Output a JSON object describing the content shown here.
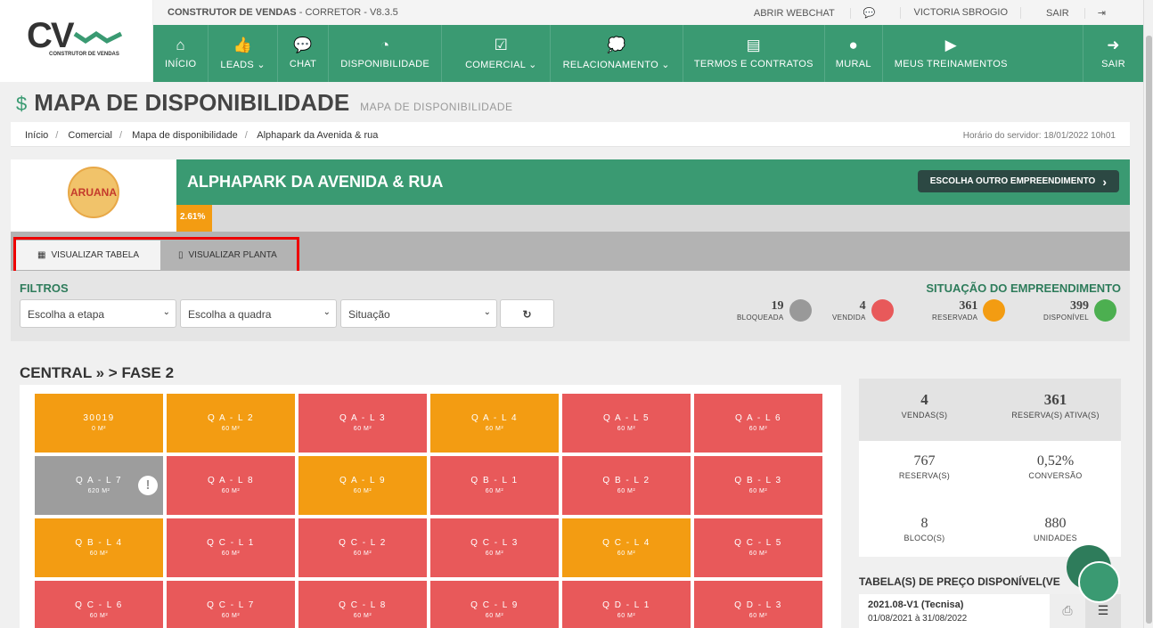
{
  "app": {
    "name": "CONSTRUTOR DE VENDAS",
    "role": "CORRETOR",
    "version": "V8.3.5",
    "logo_text": "CV",
    "logo_sub": "CONSTRUTOR DE VENDAS"
  },
  "topbar": {
    "webchat": "ABRIR WEBCHAT",
    "user": "VICTORIA SBROGIO",
    "logout": "SAIR"
  },
  "nav": [
    {
      "label": "INÍCIO",
      "icon": "home-icon"
    },
    {
      "label": "LEADS ⌄",
      "icon": "thumbs-up-icon"
    },
    {
      "label": "CHAT",
      "icon": "chat-icon"
    },
    {
      "label": "DISPONIBILIDADE",
      "icon": "dashboard-icon"
    },
    {
      "label": "COMERCIAL ⌄",
      "icon": "check-icon"
    },
    {
      "label": "RELACIONAMENTO ⌄",
      "icon": "comments-icon"
    },
    {
      "label": "TERMOS E CONTRATOS",
      "icon": "document-icon"
    },
    {
      "label": "MURAL",
      "icon": "speech-icon"
    },
    {
      "label": "MEUS TREINAMENTOS",
      "icon": "play-icon"
    },
    {
      "label": "SAIR",
      "icon": "exit-icon"
    }
  ],
  "page": {
    "title": "MAPA DE DISPONIBILIDADE",
    "subtitle": "MAPA DE DISPONIBILIDADE"
  },
  "breadcrumb": [
    "Início",
    "Comercial",
    "Mapa de disponibilidade",
    "Alphapark da Avenida & rua"
  ],
  "server_time": "Horário do servidor: 18/01/2022 10h01",
  "project": {
    "name": "ALPHAPARK DA AVENIDA & RUA",
    "progress_label": "2.61%",
    "progress": 2.61,
    "logo_text": "ARUANA",
    "choose_button": "ESCOLHA OUTRO EMPREENDIMENTO"
  },
  "tabs": {
    "table": "VISUALIZAR TABELA",
    "plan": "VISUALIZAR PLANTA"
  },
  "filters": {
    "title": "FILTROS",
    "etapa": "Escolha a etapa",
    "quadra": "Escolha a quadra",
    "situacao": "Situação",
    "reset": "↻"
  },
  "situation": {
    "title": "SITUAÇÃO DO EMPREENDIMENTO",
    "items": [
      {
        "count": "19",
        "label": "BLOQUEADA",
        "color": "#999999"
      },
      {
        "count": "4",
        "label": "VENDIDA",
        "color": "#e8595a"
      },
      {
        "count": "361",
        "label": "RESERVADA",
        "color": "#f39c12"
      },
      {
        "count": "399",
        "label": "DISPONÍVEL",
        "color": "#4caf50"
      }
    ]
  },
  "section_title": "CENTRAL » > FASE 2",
  "units": [
    [
      {
        "label": "30019",
        "size": "0 M²",
        "status": "orange"
      },
      {
        "label": "Q A - L 2",
        "size": "60 M²",
        "status": "orange"
      },
      {
        "label": "Q A - L 3",
        "size": "60 M²",
        "status": "red"
      },
      {
        "label": "Q A - L 4",
        "size": "60 M²",
        "status": "orange"
      },
      {
        "label": "Q A - L 5",
        "size": "60 M²",
        "status": "red"
      },
      {
        "label": "Q A - L 6",
        "size": "60 M²",
        "status": "red"
      }
    ],
    [
      {
        "label": "Q A - L 7",
        "size": "620 M²",
        "status": "gray"
      },
      {
        "label": "Q A - L 8",
        "size": "60 M²",
        "status": "red"
      },
      {
        "label": "Q A - L 9",
        "size": "60 M²",
        "status": "orange"
      },
      {
        "label": "Q B - L 1",
        "size": "60 M²",
        "status": "red"
      },
      {
        "label": "Q B - L 2",
        "size": "60 M²",
        "status": "red"
      },
      {
        "label": "Q B - L 3",
        "size": "60 M²",
        "status": "red"
      }
    ],
    [
      {
        "label": "Q B - L 4",
        "size": "60 M²",
        "status": "orange"
      },
      {
        "label": "Q C - L 1",
        "size": "60 M²",
        "status": "red"
      },
      {
        "label": "Q C - L 2",
        "size": "60 M²",
        "status": "red"
      },
      {
        "label": "Q C - L 3",
        "size": "60 M²",
        "status": "red"
      },
      {
        "label": "Q C - L 4",
        "size": "60 M²",
        "status": "orange"
      },
      {
        "label": "Q C - L 5",
        "size": "60 M²",
        "status": "red"
      }
    ],
    [
      {
        "label": "Q C - L 6",
        "size": "60 M²",
        "status": "red"
      },
      {
        "label": "Q C - L 7",
        "size": "60 M²",
        "status": "red"
      },
      {
        "label": "Q C - L 8",
        "size": "60 M²",
        "status": "red"
      },
      {
        "label": "Q C - L 9",
        "size": "60 M²",
        "status": "red"
      },
      {
        "label": "Q D - L 1",
        "size": "60 M²",
        "status": "red"
      },
      {
        "label": "Q D - L 3",
        "size": "60 M²",
        "status": "red"
      }
    ]
  ],
  "colors": {
    "orange": "#f39c12",
    "red": "#e8595a",
    "gray": "#9d9d9d",
    "green": "#3a9a72"
  },
  "kpis": {
    "vendas": {
      "n": "4",
      "t": "VENDAS(S)"
    },
    "reservas_ativas": {
      "n": "361",
      "t": "RESERVA(S) ATIVA(S)"
    },
    "reserva": {
      "n": "767",
      "t": "RESERVA(S)"
    },
    "conversao": {
      "n": "0,52%",
      "t": "CONVERSÃO"
    },
    "bloco": {
      "n": "8",
      "t": "BLOCO(S)"
    },
    "unidades": {
      "n": "880",
      "t": "UNIDADES"
    }
  },
  "price": {
    "title": "TABELA(S) DE PREÇO DISPONÍVEL(VE",
    "name": "2021.08-V1 (Tecnisa)",
    "period": "01/08/2021 à 31/08/2022"
  }
}
